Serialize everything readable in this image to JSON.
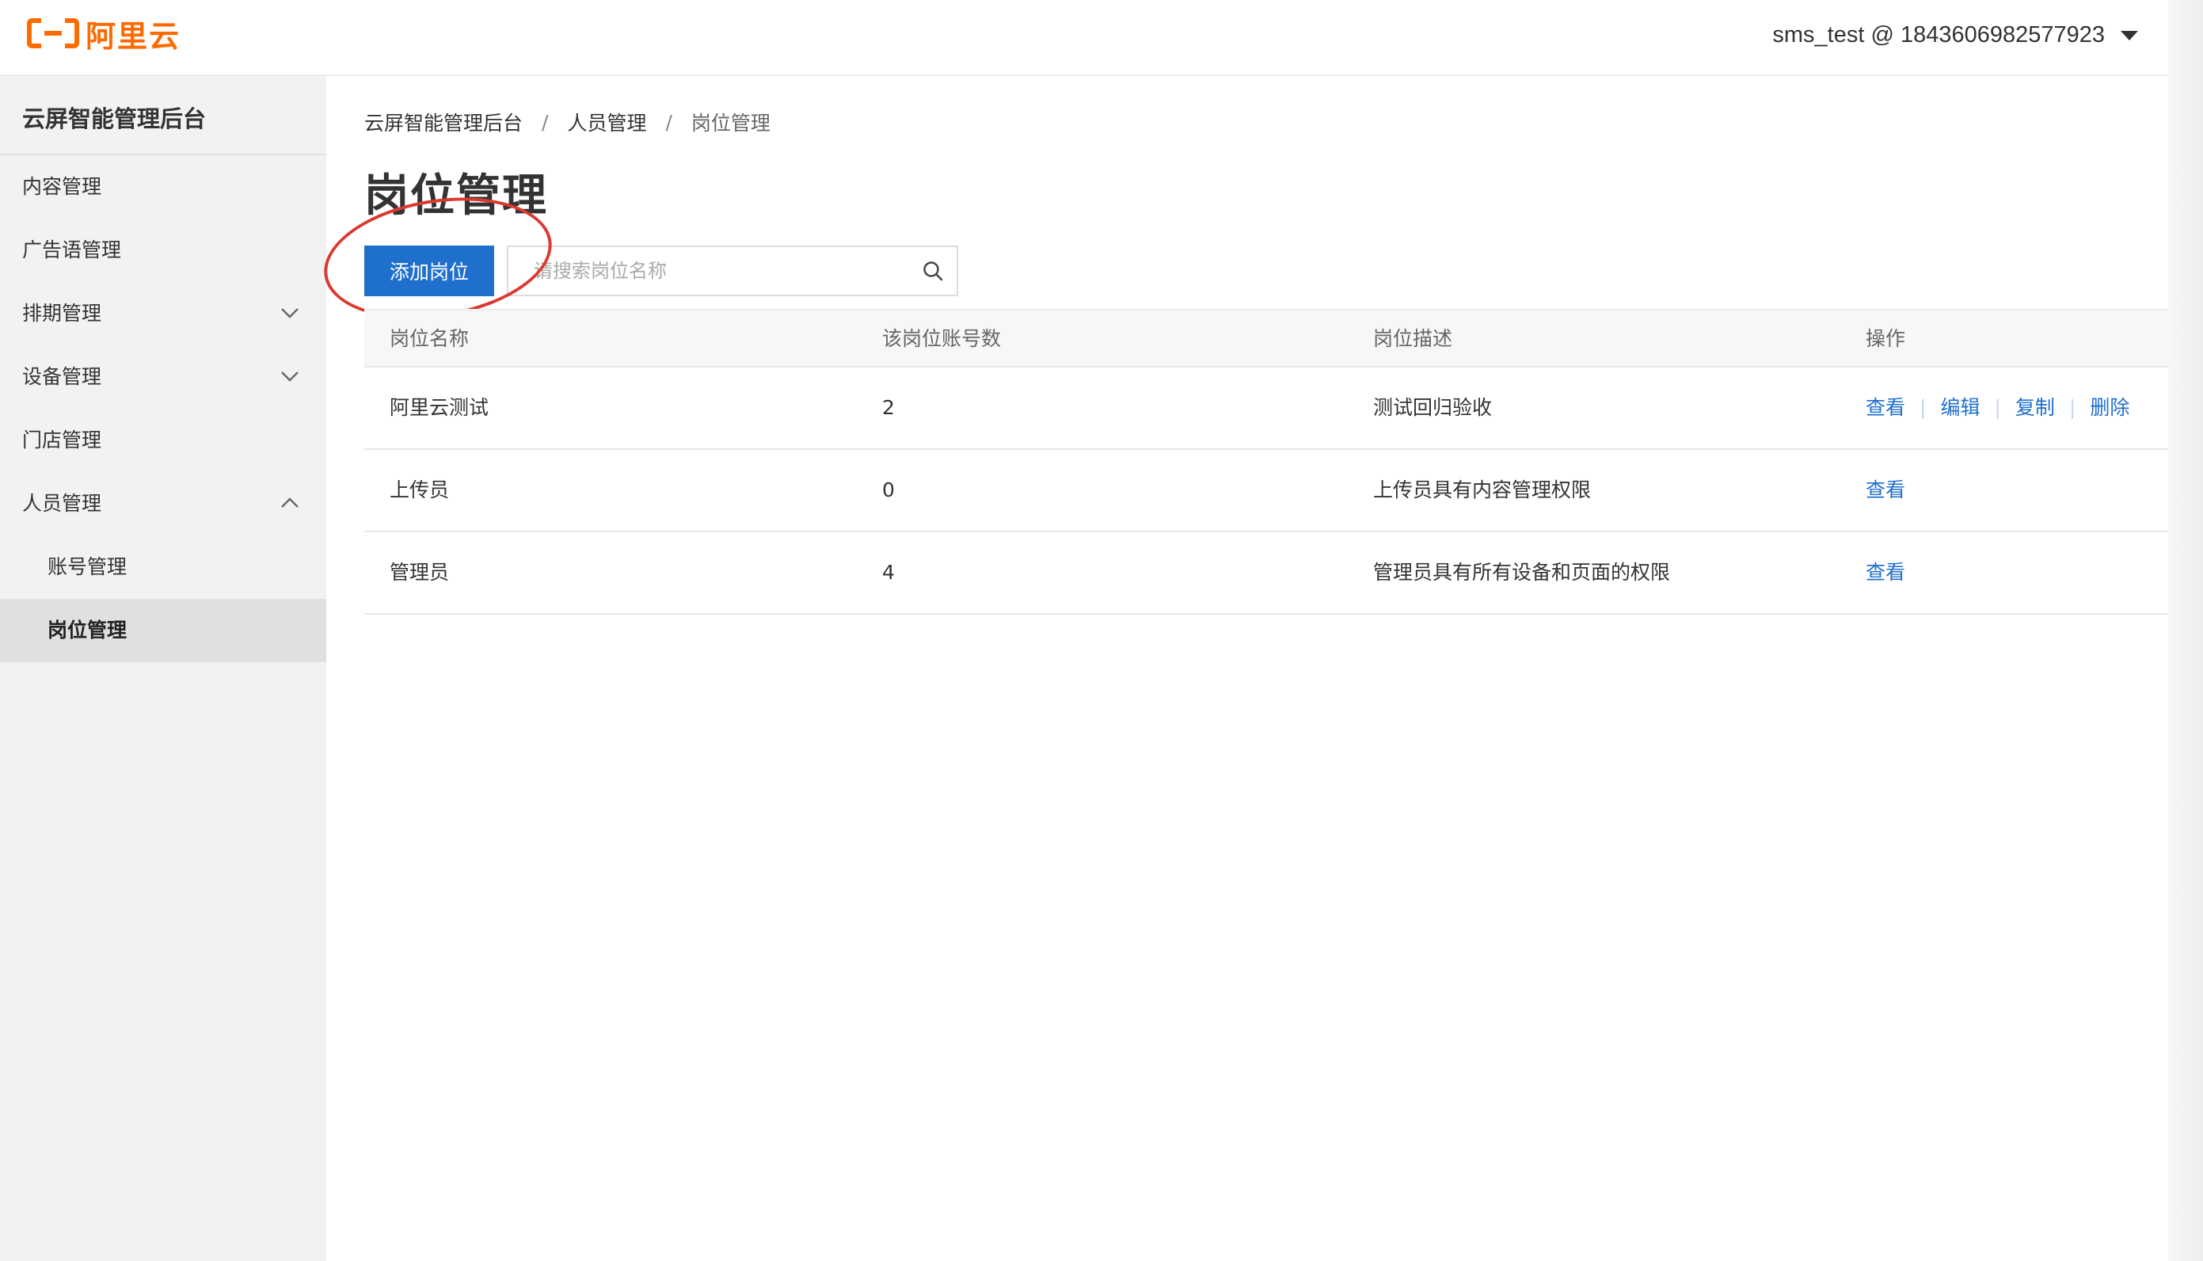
{
  "topbar": {
    "logo_text": "阿里云",
    "account": "sms_test @ 1843606982577923"
  },
  "colors": {
    "brand": "#ff6a00",
    "primary": "#1f6fcc",
    "annotation": "#d93a2f"
  },
  "sidebar": {
    "title": "云屏智能管理后台",
    "items": [
      {
        "label": "内容管理"
      },
      {
        "label": "广告语管理"
      },
      {
        "label": "排期管理",
        "expandable": true,
        "expanded": false
      },
      {
        "label": "设备管理",
        "expandable": true,
        "expanded": false
      },
      {
        "label": "门店管理"
      },
      {
        "label": "人员管理",
        "expandable": true,
        "expanded": true
      },
      {
        "label": "账号管理",
        "sub": true
      },
      {
        "label": "岗位管理",
        "sub": true,
        "active": true
      }
    ]
  },
  "breadcrumb": [
    "云屏智能管理后台",
    "人员管理",
    "岗位管理"
  ],
  "page": {
    "title": "岗位管理",
    "add_button": "添加岗位",
    "search_placeholder": "请搜索岗位名称"
  },
  "table": {
    "headers": [
      "岗位名称",
      "该岗位账号数",
      "岗位描述",
      "操作"
    ],
    "rows": [
      {
        "name": "阿里云测试",
        "count": "2",
        "desc": "测试回归验收",
        "actions": [
          "查看",
          "编辑",
          "复制",
          "删除"
        ]
      },
      {
        "name": "上传员",
        "count": "0",
        "desc": "上传员具有内容管理权限",
        "actions": [
          "查看"
        ]
      },
      {
        "name": "管理员",
        "count": "4",
        "desc": "管理员具有所有设备和页面的权限",
        "actions": [
          "查看"
        ]
      }
    ]
  }
}
